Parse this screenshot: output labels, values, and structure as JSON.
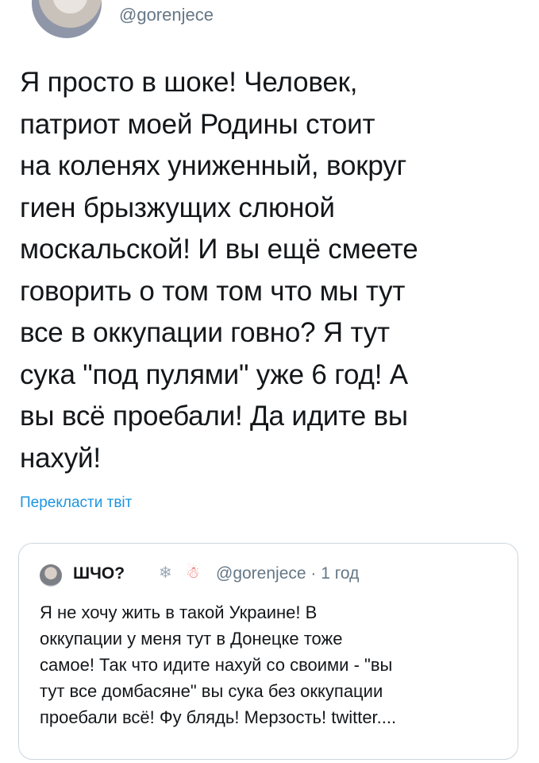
{
  "tweet": {
    "handle": "@gorenjece",
    "text": "Я просто в шоке! Человек,\nпатриот моей Родины стоит\nна коленях униженный, вокруг\nгиен брызжущих слюной\nмоскальской! И вы ещё смеете\nговорить о том том что мы тут\nвсе в оккупации говно? Я тут\nсука \"под пулями\" уже 6 год! А\nвы всё проебали! Да идите вы\nнахуй!",
    "translate_label": "Перекласти твіт"
  },
  "quote": {
    "name": "ШЧО?",
    "emoji_1": "❄",
    "emoji_2": "☃",
    "handle_time": "@gorenjece · 1 год",
    "text": "Я не хочу жить в такой Украине! В\nоккупации у меня тут в Донецке тоже\nсамое! Так что идите нахуй со своими - \"вы\nтут все домбасяне\" вы сука без оккупации\nпроебали всё! Фу блядь! Мерзость! twitter...."
  }
}
